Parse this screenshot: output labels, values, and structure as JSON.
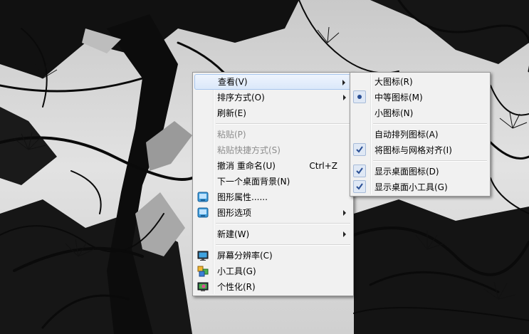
{
  "context_menu": {
    "items": [
      {
        "label": "查看(V)"
      },
      {
        "label": "排序方式(O)"
      },
      {
        "label": "刷新(E)"
      },
      {
        "label": "粘贴(P)"
      },
      {
        "label": "粘贴快捷方式(S)"
      },
      {
        "label": "撤消 重命名(U)",
        "shortcut": "Ctrl+Z"
      },
      {
        "label": "下一个桌面背景(N)"
      },
      {
        "label": "图形属性......"
      },
      {
        "label": "图形选项"
      },
      {
        "label": "新建(W)"
      },
      {
        "label": "屏幕分辨率(C)"
      },
      {
        "label": "小工具(G)"
      },
      {
        "label": "个性化(R)"
      }
    ]
  },
  "view_submenu": {
    "items": [
      {
        "label": "大图标(R)"
      },
      {
        "label": "中等图标(M)",
        "selected": true
      },
      {
        "label": "小图标(N)"
      },
      {
        "label": "自动排列图标(A)"
      },
      {
        "label": "将图标与网格对齐(I)",
        "checked": true
      },
      {
        "label": "显示桌面图标(D)",
        "checked": true
      },
      {
        "label": "显示桌面小工具(G)",
        "checked": true
      }
    ]
  },
  "icons": {
    "graphics_properties": "intel-graphics-icon",
    "graphics_options": "intel-graphics-icon",
    "screen_resolution": "display-monitor-icon",
    "gadgets": "gadgets-icon",
    "personalize": "personalize-icon"
  },
  "colors": {
    "menu_bg": "#f1f1f1",
    "menu_border": "#979797",
    "hover_border": "#a8c6ee",
    "disabled_text": "#8d8d8d",
    "check_mark": "#2a4f94"
  }
}
